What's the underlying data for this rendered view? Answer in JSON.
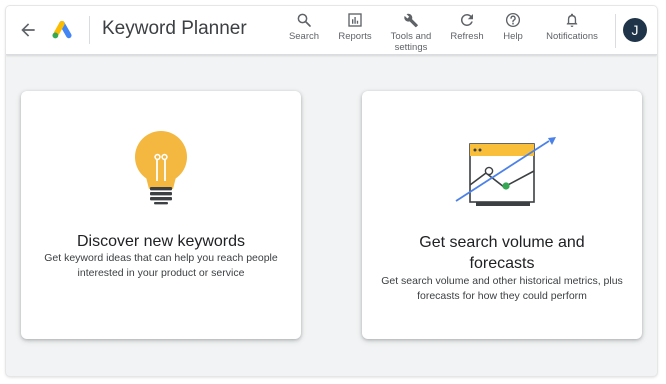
{
  "header": {
    "back_icon": "arrow-back-icon",
    "logo_icon": "google-ads-logo-icon",
    "title": "Keyword Planner",
    "tools": [
      {
        "label": "Search",
        "icon": "search-icon"
      },
      {
        "label": "Reports",
        "icon": "bar-chart-icon"
      },
      {
        "label": "Tools and\nsettings",
        "icon": "wrench-icon"
      },
      {
        "label": "Refresh",
        "icon": "refresh-icon"
      },
      {
        "label": "Help",
        "icon": "help-circle-icon"
      },
      {
        "label": "Notifications",
        "icon": "bell-icon"
      }
    ],
    "avatar_initial": "J"
  },
  "cards": [
    {
      "icon": "lightbulb-illustration",
      "title": "Discover new keywords",
      "description": "Get keyword ideas that can help you reach people interested in your product or service"
    },
    {
      "icon": "trend-chart-illustration",
      "title": "Get search volume and forecasts",
      "description": "Get search volume and other historical metrics, plus forecasts for how they could perform"
    }
  ],
  "colors": {
    "page_background": "#f1f3f4",
    "bulb_yellow": "#f4b73f",
    "chart_window_yellow": "#f9bf3b",
    "trend_blue": "#4c82e8",
    "point_green": "#34a853",
    "avatar_bg": "#1f3449"
  }
}
